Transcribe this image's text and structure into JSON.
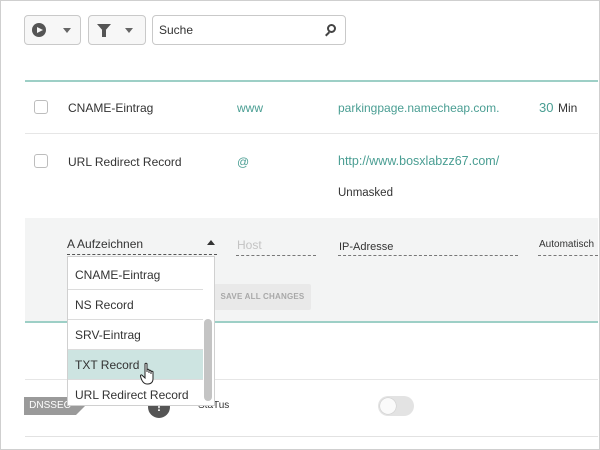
{
  "toolbar": {
    "play_icon": "play-circle-icon",
    "filter_icon": "filter-icon",
    "search_value": "Suche",
    "search_icon": "search-icon"
  },
  "records": [
    {
      "type": "CNAME-Eintrag",
      "host": "www",
      "value": "parkingpage.namecheap.com.",
      "ttl_num": "30",
      "ttl_unit": "Min"
    },
    {
      "type": "URL Redirect Record",
      "host": "@",
      "value": "http://www.bosxlabzz67.com/",
      "mode": "Unmasked"
    }
  ],
  "new_record": {
    "type_value": "A Aufzeichnen",
    "host_placeholder": "Host",
    "ip_label": "IP-Adresse",
    "ttl_label": "Automatisch",
    "save_label": "SAVE ALL CHANGES"
  },
  "dropdown": {
    "options": [
      "CNAME-Eintrag",
      "NS Record",
      "SRV-Eintrag",
      "TXT Record",
      "URL Redirect Record"
    ],
    "highlighted": "TXT Record"
  },
  "dnssec": {
    "badge": "DNSSEC",
    "status_label": "StaTus",
    "info_icon": "!"
  },
  "colors": {
    "accent_teal": "#4a9e93",
    "divider_teal": "#9dcfc6",
    "highlight": "#cde4e1"
  }
}
